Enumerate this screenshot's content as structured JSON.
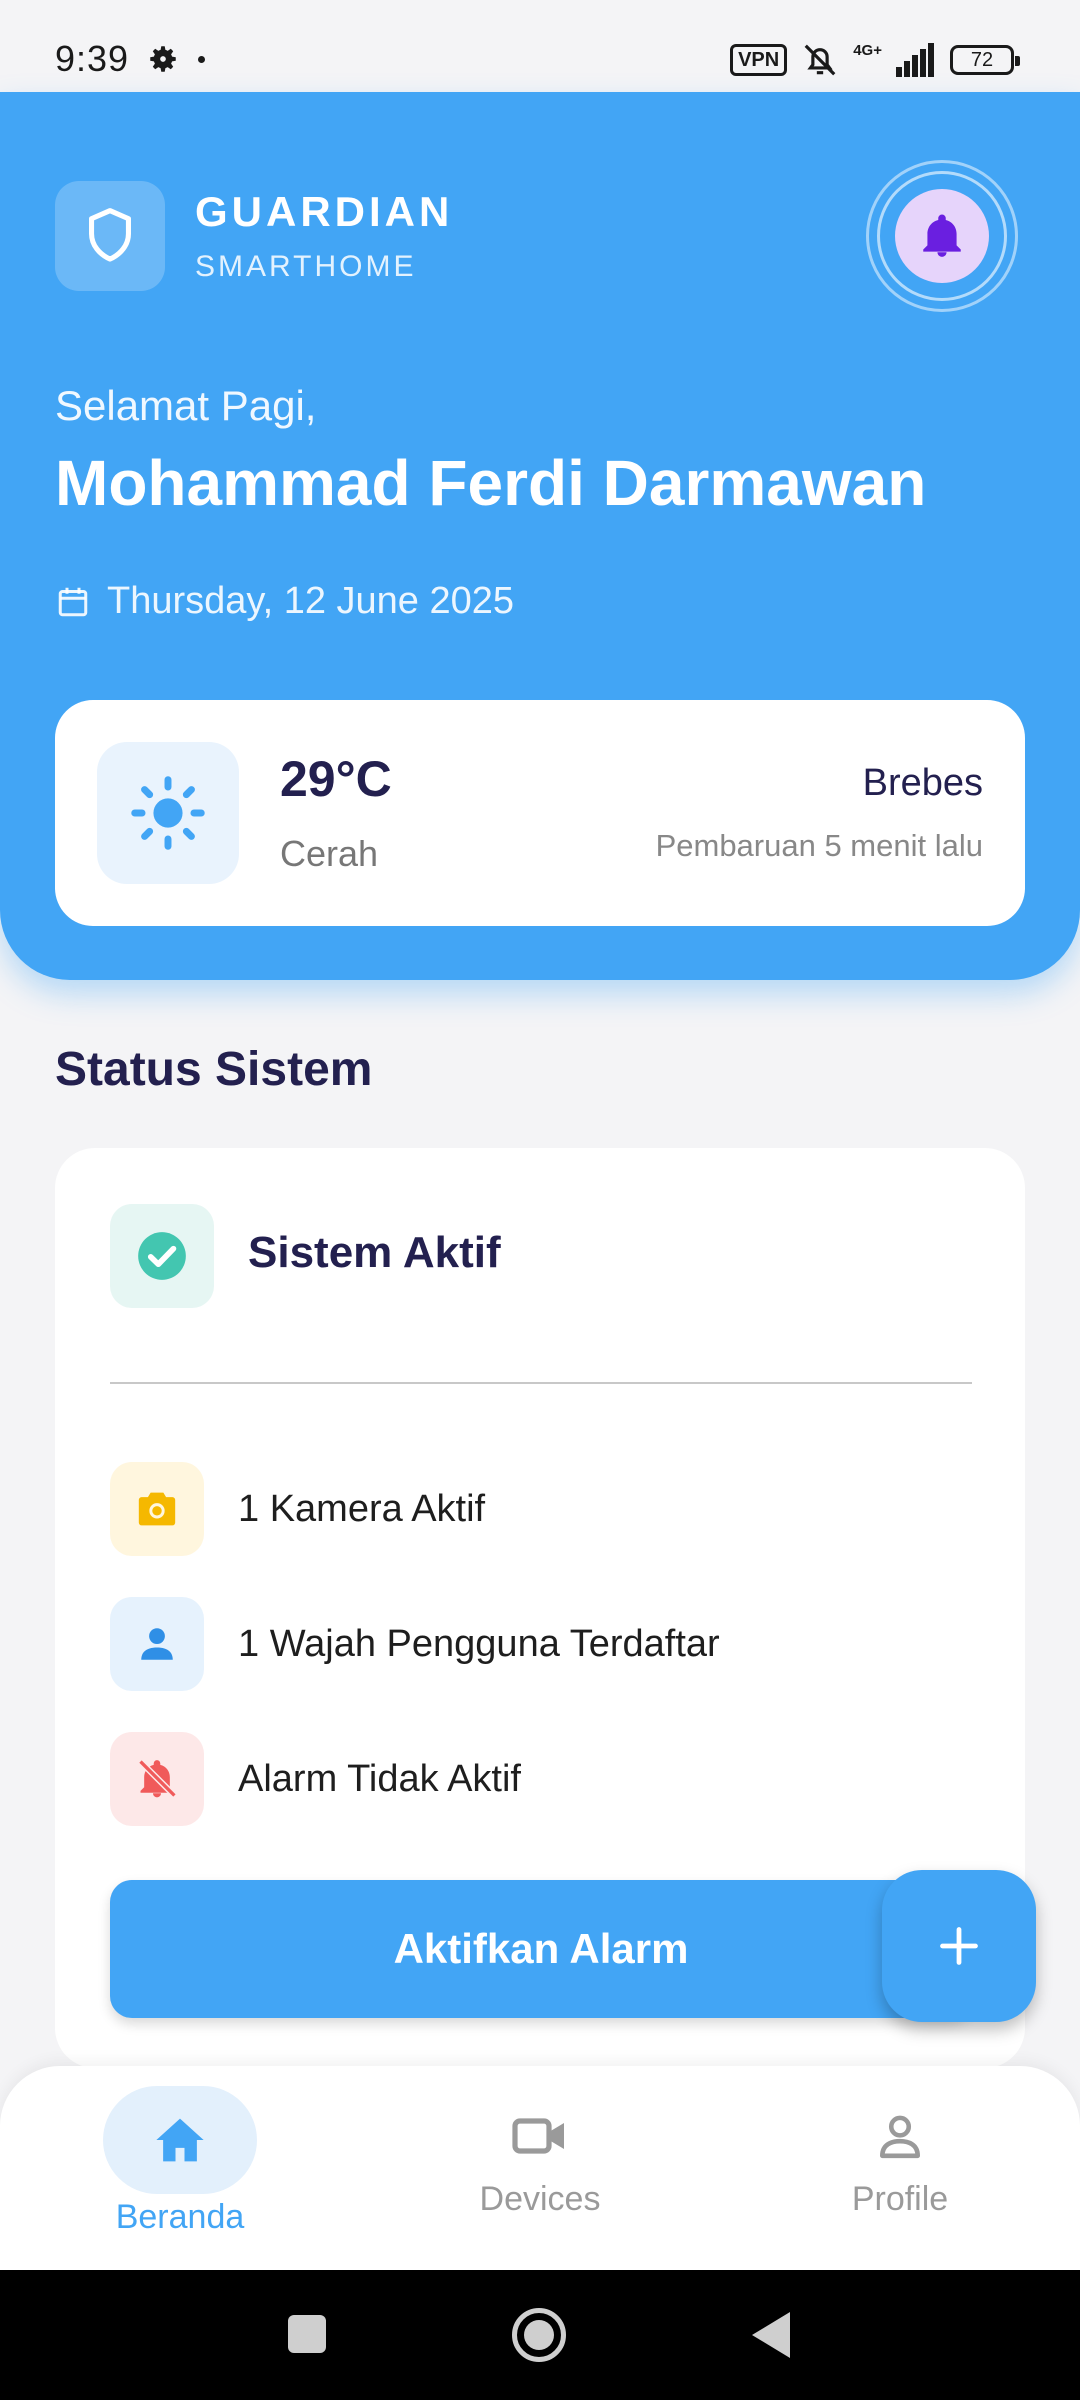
{
  "status_bar": {
    "time": "9:39",
    "vpn": "VPN",
    "network": "4G+",
    "battery": "72",
    "icons": [
      "gear-icon",
      "notifications-muted-icon",
      "signal-icon",
      "battery-icon"
    ]
  },
  "header": {
    "brand_title": "GUARDIAN",
    "brand_subtitle": "SMARTHOME",
    "greeting": "Selamat Pagi,",
    "user_name": "Mohammad Ferdi Darmawan",
    "date": "Thursday, 12 June 2025",
    "accent_color": "#42a5f5",
    "bell_color": "#6a1fe0"
  },
  "weather": {
    "temperature": "29°C",
    "condition": "Cerah",
    "city": "Brebes",
    "updated": "Pembaruan 5 menit lalu",
    "icon": "sun-icon"
  },
  "system_status": {
    "section_title": "Status Sistem",
    "main_label": "Sistem Aktif",
    "main_color": "#43c6b0",
    "items": [
      {
        "label": "1 Kamera Aktif",
        "icon": "camera-icon",
        "color": "#f5b800",
        "bg": "#fff6de"
      },
      {
        "label": "1 Wajah Pengguna Terdaftar",
        "icon": "person-icon",
        "color": "#2f8fe6",
        "bg": "#e6f2fd"
      },
      {
        "label": "Alarm Tidak Aktif",
        "icon": "alarm-off-icon",
        "color": "#f05a5a",
        "bg": "#fde8e8"
      }
    ],
    "button_label": "Aktifkan Alarm"
  },
  "fab": {
    "icon": "plus-icon"
  },
  "bottom_nav": {
    "items": [
      {
        "label": "Beranda",
        "icon": "home-icon",
        "active": true
      },
      {
        "label": "Devices",
        "icon": "videocam-icon",
        "active": false
      },
      {
        "label": "Profile",
        "icon": "person-outline-icon",
        "active": false
      }
    ]
  }
}
